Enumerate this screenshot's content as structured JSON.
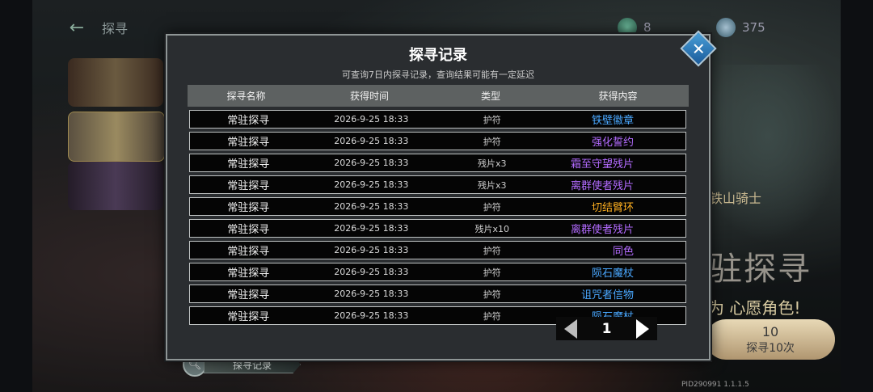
{
  "top": {
    "title": "探寻",
    "gem1_count": "8",
    "gem2_count": "375"
  },
  "background": {
    "hero_name": "铁山骑士",
    "big_title": "驻探寻",
    "wish_text": "为 心愿角色!",
    "draw_count": "10",
    "draw_label": "探寻10次",
    "pid": "PID290991  1.1.1.5"
  },
  "record_button_label": "探寻记录",
  "modal": {
    "title": "探寻记录",
    "subtitle": "可查询7日内探寻记录，查询结果可能有一定延迟",
    "headers": [
      "探寻名称",
      "获得时间",
      "类型",
      "获得内容"
    ],
    "rows": [
      {
        "name": "常驻探寻",
        "time": "2026-9-25 18:33",
        "type": "护符",
        "content": "铁壁徽章",
        "color": "#4aa8ff"
      },
      {
        "name": "常驻探寻",
        "time": "2026-9-25 18:33",
        "type": "护符",
        "content": "强化誓约",
        "color": "#b36bff"
      },
      {
        "name": "常驻探寻",
        "time": "2026-9-25 18:33",
        "type": "残片x3",
        "content": "霜至守望残片",
        "color": "#b36bff"
      },
      {
        "name": "常驻探寻",
        "time": "2026-9-25 18:33",
        "type": "残片x3",
        "content": "离群使者残片",
        "color": "#b36bff"
      },
      {
        "name": "常驻探寻",
        "time": "2026-9-25 18:33",
        "type": "护符",
        "content": "切结臂环",
        "color": "#ffb020"
      },
      {
        "name": "常驻探寻",
        "time": "2026-9-25 18:33",
        "type": "残片x10",
        "content": "离群使者残片",
        "color": "#b36bff"
      },
      {
        "name": "常驻探寻",
        "time": "2026-9-25 18:33",
        "type": "护符",
        "content": "同色",
        "color": "#b36bff"
      },
      {
        "name": "常驻探寻",
        "time": "2026-9-25 18:33",
        "type": "护符",
        "content": "陨石魔杖",
        "color": "#4aa8ff"
      },
      {
        "name": "常驻探寻",
        "time": "2026-9-25 18:33",
        "type": "护符",
        "content": "诅咒者信物",
        "color": "#4aa8ff"
      },
      {
        "name": "常驻探寻",
        "time": "2026-9-25 18:33",
        "type": "护符",
        "content": "陨石魔杖",
        "color": "#4aa8ff"
      }
    ],
    "page_number": "1"
  },
  "icons": {
    "back": "back-arrow-icon",
    "close": "close-icon",
    "search": "magnifier-icon",
    "prev": "prev-page-icon",
    "next": "next-page-icon"
  }
}
